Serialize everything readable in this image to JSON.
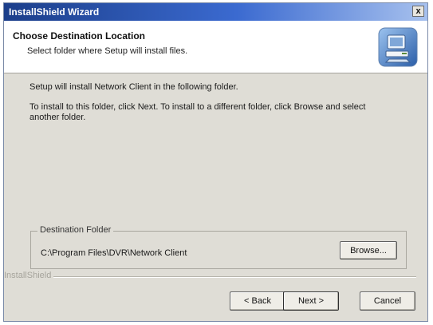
{
  "window": {
    "title": "InstallShield Wizard",
    "close_label": "x"
  },
  "header": {
    "title": "Choose Destination Location",
    "subtitle": "Select folder where Setup will install files.",
    "icon": "computer-install-icon"
  },
  "body": {
    "line1": "Setup will install Network Client in the following folder.",
    "line2": "To install to this folder, click Next. To install to a different folder, click Browse and select another folder."
  },
  "destination": {
    "legend": "Destination Folder",
    "path": "C:\\Program Files\\DVR\\Network Client",
    "browse_label": "Browse..."
  },
  "footer": {
    "brand": "InstallShield",
    "back_label": "< Back",
    "next_label": "Next >",
    "cancel_label": "Cancel"
  },
  "colors": {
    "titlebar_start": "#1b3e8a",
    "titlebar_end": "#a7c1ee",
    "dialog_bg": "#dfddd6"
  }
}
